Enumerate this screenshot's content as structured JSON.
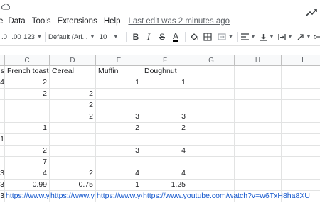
{
  "menubar": {
    "partial_first": "e",
    "items": [
      "Data",
      "Tools",
      "Extensions",
      "Help"
    ],
    "last_edit": "Last edit was 2 minutes ago"
  },
  "toolbar": {
    "decimal_decrease": ".0",
    "decimal_increase": ".00",
    "format_more": "123",
    "font": "Default (Ari...",
    "font_size": "10",
    "bold": "B",
    "italic": "I",
    "strike": "S",
    "text_color": "A"
  },
  "columns": [
    "C",
    "D",
    "E",
    "F",
    "G",
    "H",
    "I"
  ],
  "row_stub": [
    "s",
    "4",
    "",
    "",
    "",
    "",
    "1",
    "",
    "",
    "3",
    "3",
    "3",
    ""
  ],
  "rows": [
    [
      "French toast",
      "Cereal",
      "Muffin",
      "Doughnut",
      "",
      "",
      ""
    ],
    [
      "2",
      "",
      "1",
      "1",
      "",
      "",
      ""
    ],
    [
      "2",
      "2",
      "",
      "",
      "",
      "",
      ""
    ],
    [
      "",
      "2",
      "",
      "",
      "",
      "",
      ""
    ],
    [
      "",
      "2",
      "3",
      "3",
      "",
      "",
      ""
    ],
    [
      "1",
      "",
      "2",
      "2",
      "",
      "",
      ""
    ],
    [
      "",
      "",
      "",
      "",
      "",
      "",
      ""
    ],
    [
      "2",
      "",
      "3",
      "4",
      "",
      "",
      ""
    ],
    [
      "7",
      "",
      "",
      "",
      "",
      "",
      ""
    ],
    [
      "4",
      "2",
      "4",
      "4",
      "",
      "",
      ""
    ],
    [
      "0.99",
      "0.75",
      "1",
      "1.25",
      "",
      "",
      ""
    ],
    [
      "https://www.yout",
      "https://www.yout",
      "https://www.yout",
      "https://www.youtube.com/watch?v=w6TxH8ha8XU",
      "",
      "",
      ""
    ]
  ],
  "colors": {
    "link": "#1155cc",
    "header_bg": "#f8f9fa",
    "grid_line": "#e2e3e3"
  }
}
